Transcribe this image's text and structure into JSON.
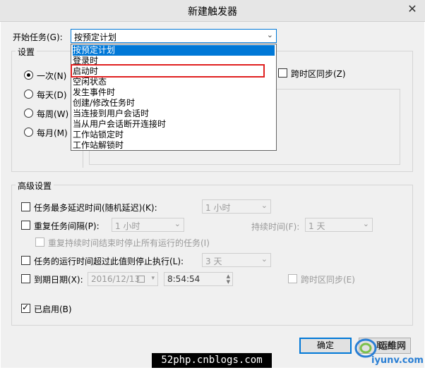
{
  "window": {
    "title": "新建触发器",
    "close_glyph": "✕"
  },
  "begin_task": {
    "label": "开始任务(G):",
    "value": "按预定计划",
    "arrow": "⌄"
  },
  "settings": {
    "group_title": "设置",
    "radios": [
      {
        "label": "一次(N)",
        "checked": true
      },
      {
        "label": "每天(D)",
        "checked": false
      },
      {
        "label": "每周(W)",
        "checked": false
      },
      {
        "label": "每月(M)",
        "checked": false
      }
    ],
    "sync_timezone_label": "跨时区同步(Z)"
  },
  "dropdown": {
    "items": [
      "按预定计划",
      "登录时",
      "启动时",
      "空闲状态",
      "发生事件时",
      "创建/修改任务时",
      "当连接到用户会话时",
      "当从用户会话断开连接时",
      "工作站锁定时",
      "工作站解锁时"
    ],
    "highlighted_index": 0,
    "annotated_index": 2
  },
  "advanced": {
    "group_title": "高级设置",
    "delay": {
      "label": "任务最多延迟时间(随机延迟)(K):",
      "value": "1 小时"
    },
    "repeat": {
      "label": "重复任务间隔(P):",
      "value": "1 小时",
      "duration_label": "持续时间(F):",
      "duration_value": "1 天"
    },
    "stop_running_label": "重复持续时间结束时停止所有运行的任务(I)",
    "stop_longer": {
      "label": "任务的运行时间超过此值则停止执行(L):",
      "value": "3 天"
    },
    "expire": {
      "label": "到期日期(X):",
      "date": "2016/12/13",
      "time": "8:54:54",
      "sync_label": "跨时区同步(E)"
    },
    "enabled": {
      "label": "已启用(B)",
      "checked": true
    }
  },
  "buttons": {
    "ok": "确定",
    "cancel": "取消"
  },
  "watermark": {
    "text": "52php.cnblogs.com",
    "logo_text_top": "运维网",
    "logo_text_bottom": "iyunv.com"
  },
  "colors": {
    "accent": "#0078d7",
    "annotation": "#e02020"
  }
}
